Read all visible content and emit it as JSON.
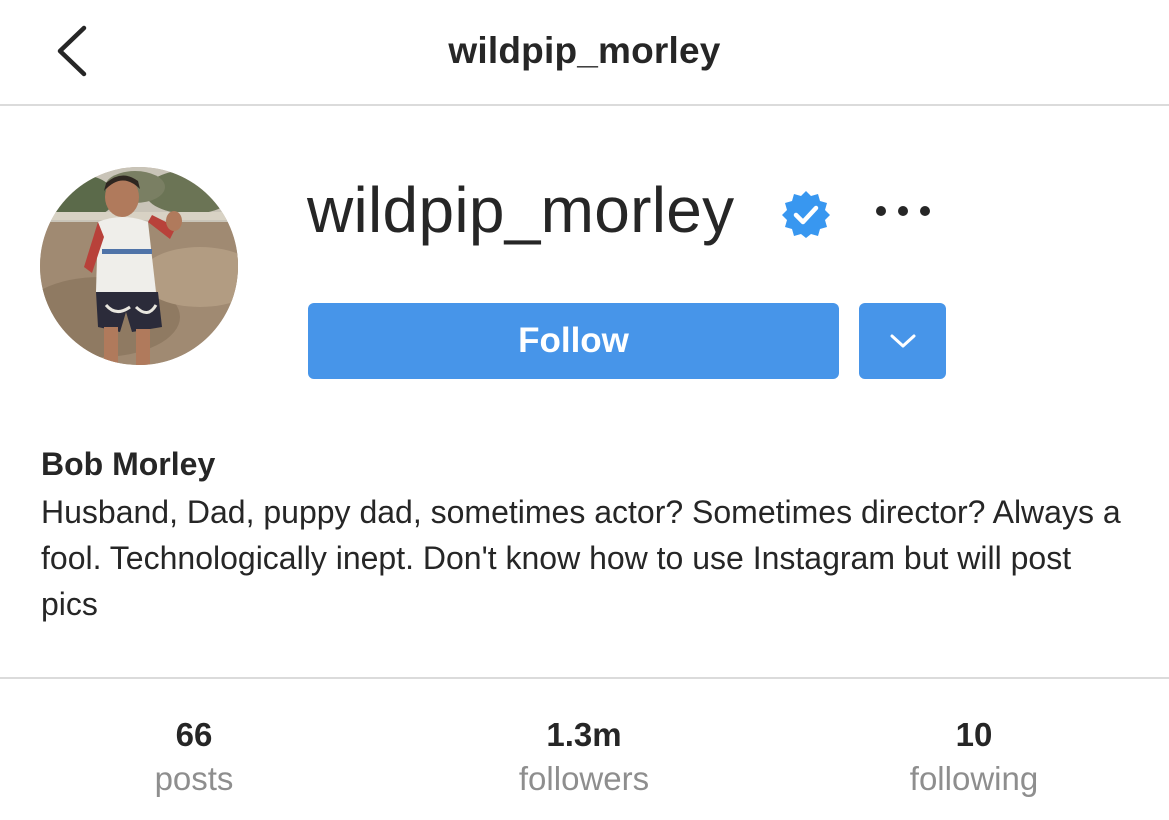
{
  "nav": {
    "title": "wildpip_morley",
    "back_icon": "chevron-left-icon"
  },
  "profile": {
    "username": "wildpip_morley",
    "verified_icon": "verified-badge-icon",
    "more_icon": "more-horizontal-icon",
    "full_name": "Bob Morley",
    "bio": "Husband, Dad, puppy dad, sometimes actor? Sometimes director? Always a fool. Technologically inept. Don't know how to use Instagram but will post pics"
  },
  "actions": {
    "follow_label": "Follow",
    "dropdown_icon": "chevron-down-icon"
  },
  "stats": [
    {
      "value": "66",
      "label": "posts"
    },
    {
      "value": "1.3m",
      "label": "followers"
    },
    {
      "value": "10",
      "label": "following"
    }
  ],
  "colors": {
    "accent": "#4795e9",
    "verified": "#3897f0",
    "text": "#262626",
    "muted": "#8e8e8e",
    "divider": "#dbdbdb"
  }
}
